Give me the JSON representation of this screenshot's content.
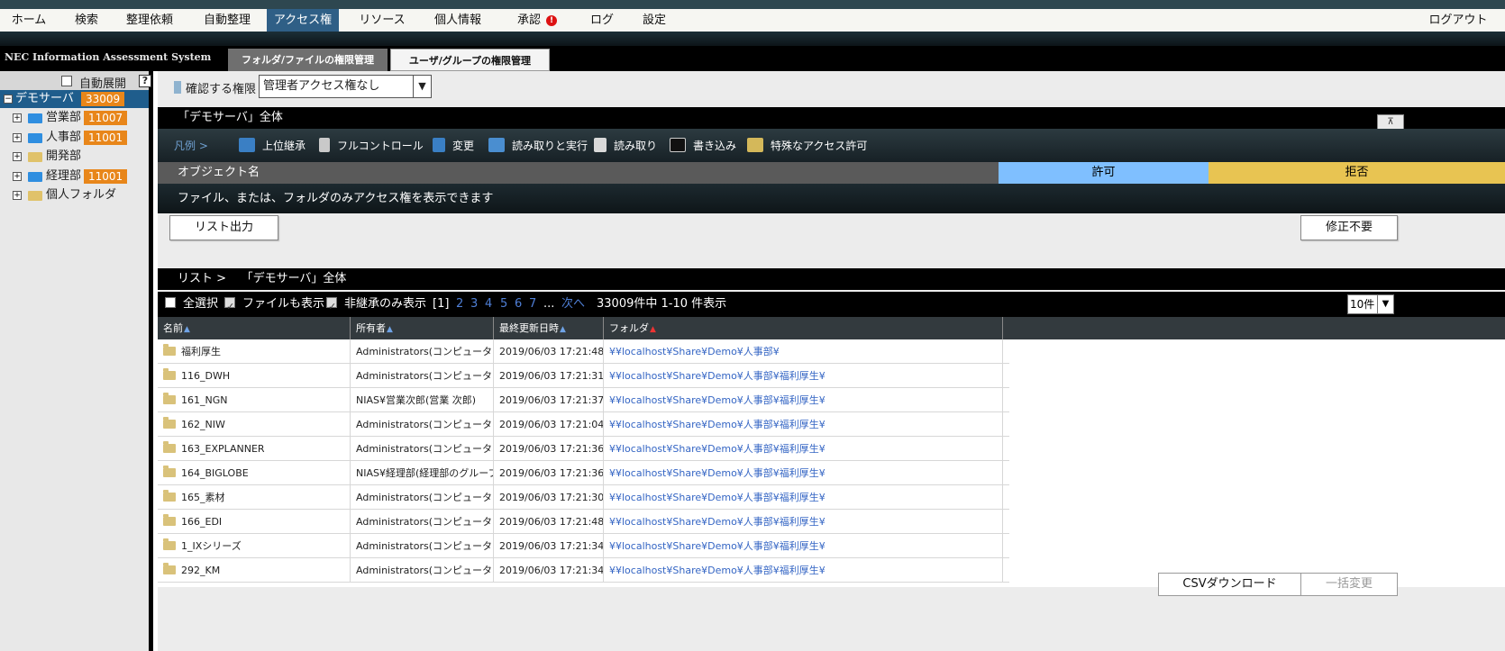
{
  "menu": {
    "items": [
      "ホーム",
      "検索",
      "整理依頼",
      "自動整理",
      "アクセス権",
      "リソース",
      "個人情報",
      "承認",
      "ログ",
      "設定"
    ],
    "approval_badge": "!",
    "logout": "ログアウト"
  },
  "system": {
    "title": "NEC Information Assessment System",
    "tab_folder": "フォルダ/ファイルの権限管理",
    "tab_user": "ユーザ/グループの権限管理"
  },
  "sidebar": {
    "auto_expand": "自動展開",
    "help": "?",
    "root": {
      "toggle": "−",
      "name": "デモサーバ",
      "count": "33009"
    },
    "nodes": [
      {
        "name": "営業部",
        "count": "11007",
        "color": "#2f8ee0"
      },
      {
        "name": "人事部",
        "count": "11001",
        "color": "#2f8ee0"
      },
      {
        "name": "開発部",
        "count": "",
        "color": "#e0c26a"
      },
      {
        "name": "経理部",
        "count": "11001",
        "color": "#2f8ee0"
      },
      {
        "name": "個人フォルダ",
        "count": "",
        "color": "#e0c26a"
      }
    ]
  },
  "permission": {
    "label": "確認する権限",
    "selected": "管理者アクセス権なし"
  },
  "scope_title": "「デモサーバ」全体",
  "collapse_icon": "⊼",
  "legend": {
    "label": "凡例 >",
    "items": [
      "上位継承",
      "フルコントロール",
      "変更",
      "読み取りと実行",
      "読み取り",
      "書き込み",
      "特殊なアクセス許可"
    ]
  },
  "object_header": {
    "name": "オブジェクト名",
    "allow": "許可",
    "deny": "拒否"
  },
  "notice": "ファイル、または、フォルダのみアクセス権を表示できます",
  "buttons": {
    "list_output": "リスト出力",
    "no_fix": "修正不要",
    "csv_download": "CSVダウンロード",
    "bulk_change": "一括変更"
  },
  "list": {
    "title_prefix": "リスト >",
    "title_scope": "「デモサーバ」全体",
    "select_all": "全選択",
    "show_files": "ファイルも表示",
    "non_inherit_only": "非継承のみ表示",
    "current_page": "[1]",
    "pages": [
      "2",
      "3",
      "4",
      "5",
      "6",
      "7"
    ],
    "ellipsis": "...",
    "next": "次へ",
    "summary": "33009件中 1-10 件表示",
    "per_page": "10件"
  },
  "table": {
    "headers": {
      "name": "名前",
      "owner": "所有者",
      "updated": "最終更新日時",
      "folder": "フォルダ"
    },
    "rows": [
      {
        "name": "福利厚生",
        "owner": "Administrators(コンピューター/",
        "updated": "2019/06/03 17:21:48",
        "folder": "¥¥localhost¥Share¥Demo¥人事部¥"
      },
      {
        "name": "116_DWH",
        "owner": "Administrators(コンピューター/",
        "updated": "2019/06/03 17:21:31",
        "folder": "¥¥localhost¥Share¥Demo¥人事部¥福利厚生¥"
      },
      {
        "name": "161_NGN",
        "owner": "NIAS¥営業次郎(営業 次郎)",
        "updated": "2019/06/03 17:21:37",
        "folder": "¥¥localhost¥Share¥Demo¥人事部¥福利厚生¥"
      },
      {
        "name": "162_NIW",
        "owner": "Administrators(コンピューター/",
        "updated": "2019/06/03 17:21:04",
        "folder": "¥¥localhost¥Share¥Demo¥人事部¥福利厚生¥"
      },
      {
        "name": "163_EXPLANNER",
        "owner": "Administrators(コンピューター/",
        "updated": "2019/06/03 17:21:36",
        "folder": "¥¥localhost¥Share¥Demo¥人事部¥福利厚生¥"
      },
      {
        "name": "164_BIGLOBE",
        "owner": "NIAS¥経理部(経理部のグループ)",
        "updated": "2019/06/03 17:21:36",
        "folder": "¥¥localhost¥Share¥Demo¥人事部¥福利厚生¥"
      },
      {
        "name": "165_素材",
        "owner": "Administrators(コンピューター/",
        "updated": "2019/06/03 17:21:30",
        "folder": "¥¥localhost¥Share¥Demo¥人事部¥福利厚生¥"
      },
      {
        "name": "166_EDI",
        "owner": "Administrators(コンピューター/",
        "updated": "2019/06/03 17:21:48",
        "folder": "¥¥localhost¥Share¥Demo¥人事部¥福利厚生¥"
      },
      {
        "name": "1_IXシリーズ",
        "owner": "Administrators(コンピューター/",
        "updated": "2019/06/03 17:21:34",
        "folder": "¥¥localhost¥Share¥Demo¥人事部¥福利厚生¥"
      },
      {
        "name": "292_KM",
        "owner": "Administrators(コンピューター/",
        "updated": "2019/06/03 17:21:34",
        "folder": "¥¥localhost¥Share¥Demo¥人事部¥福利厚生¥"
      }
    ]
  }
}
